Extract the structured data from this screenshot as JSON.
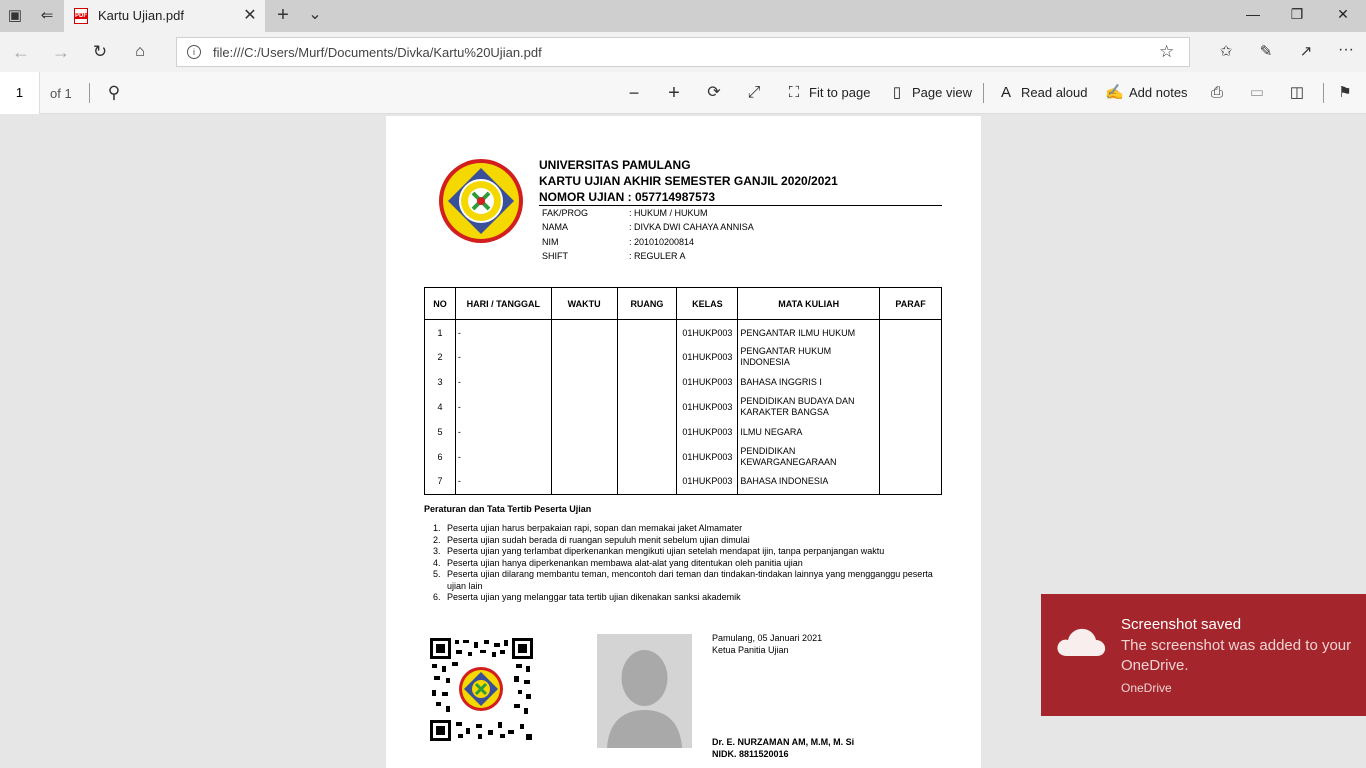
{
  "browser": {
    "tab_title": "Kartu Ujian.pdf",
    "tab_close": "✕",
    "new_tab": "+",
    "tab_menu": "⌄",
    "url": "file:///C:/Users/Murf/Documents/Divka/Kartu%20Ujian.pdf",
    "window_controls": {
      "minimize": "—",
      "restore": "❐",
      "close": "✕"
    }
  },
  "pdf_toolbar": {
    "page_number": "1",
    "page_total": "of 1",
    "fit_to_page": "Fit to page",
    "page_view": "Page view",
    "read_aloud": "Read aloud",
    "add_notes": "Add notes"
  },
  "document": {
    "university": "UNIVERSITAS PAMULANG",
    "card_title": "KARTU UJIAN AKHIR SEMESTER GANJIL 2020/2021",
    "exam_number": "NOMOR UJIAN : 057714987573",
    "info": [
      {
        "label": "FAK/PROG",
        "value": ": HUKUM / HUKUM"
      },
      {
        "label": "NAMA",
        "value": ": DIVKA DWI CAHAYA ANNISA"
      },
      {
        "label": "NIM",
        "value": ": 201010200814"
      },
      {
        "label": "SHIFT",
        "value": ": REGULER A"
      }
    ],
    "table_headers": [
      "NO",
      "HARI / TANGGAL",
      "WAKTU",
      "RUANG",
      "KELAS",
      "MATA KULIAH",
      "PARAF"
    ],
    "table_rows": [
      {
        "no": "1",
        "day": "-",
        "kelas": "01HUKP003",
        "mk": "PENGANTAR ILMU HUKUM"
      },
      {
        "no": "2",
        "day": "-",
        "kelas": "01HUKP003",
        "mk": "PENGANTAR HUKUM INDONESIA"
      },
      {
        "no": "3",
        "day": "-",
        "kelas": "01HUKP003",
        "mk": "BAHASA INGGRIS I"
      },
      {
        "no": "4",
        "day": "-",
        "kelas": "01HUKP003",
        "mk": "PENDIDIKAN BUDAYA DAN KARAKTER BANGSA"
      },
      {
        "no": "5",
        "day": "-",
        "kelas": "01HUKP003",
        "mk": "ILMU NEGARA"
      },
      {
        "no": "6",
        "day": "-",
        "kelas": "01HUKP003",
        "mk": "PENDIDIKAN KEWARGANEGARAAN"
      },
      {
        "no": "7",
        "day": "-",
        "kelas": "01HUKP003",
        "mk": "BAHASA INDONESIA"
      }
    ],
    "rules_title": "Peraturan dan Tata Tertib Peserta Ujian",
    "rules": [
      {
        "n": "1.",
        "text": "Peserta ujian harus berpakaian rapi, sopan dan memakai jaket Almamater"
      },
      {
        "n": "2.",
        "text": "Peserta ujian sudah berada di ruangan sepuluh menit sebelum ujian dimulai"
      },
      {
        "n": "3.",
        "text": "Peserta ujian yang terlambat diperkenankan mengikuti ujian setelah mendapat ijin, tanpa perpanjangan waktu"
      },
      {
        "n": "4.",
        "text": "Peserta ujian hanya diperkenankan membawa alat-alat yang ditentukan oleh panitia ujian"
      },
      {
        "n": "5.",
        "text": "Peserta ujian dilarang membantu teman, mencontoh dari teman dan tindakan-tindakan lainnya yang mengganggu peserta ujian lain"
      },
      {
        "n": "6.",
        "text": "Peserta ujian yang melanggar tata tertib ujian dikenakan sanksi akademik"
      }
    ],
    "sign_place_date": "Pamulang, 05 Januari 2021",
    "sign_role": "Ketua Panitia Ujian",
    "sign_name": "Dr. E. NURZAMAN AM, M.M, M. Si",
    "sign_nidk": "NIDK. 8811520016"
  },
  "toast": {
    "title": "Screenshot saved",
    "message": "The screenshot was added to your OneDrive.",
    "source": "OneDrive"
  },
  "colors": {
    "toast_bg": "#a4262c",
    "logo_ring": "#d21e1e",
    "logo_fill": "#f5d800",
    "logo_diamond": "#3a4f9a"
  }
}
